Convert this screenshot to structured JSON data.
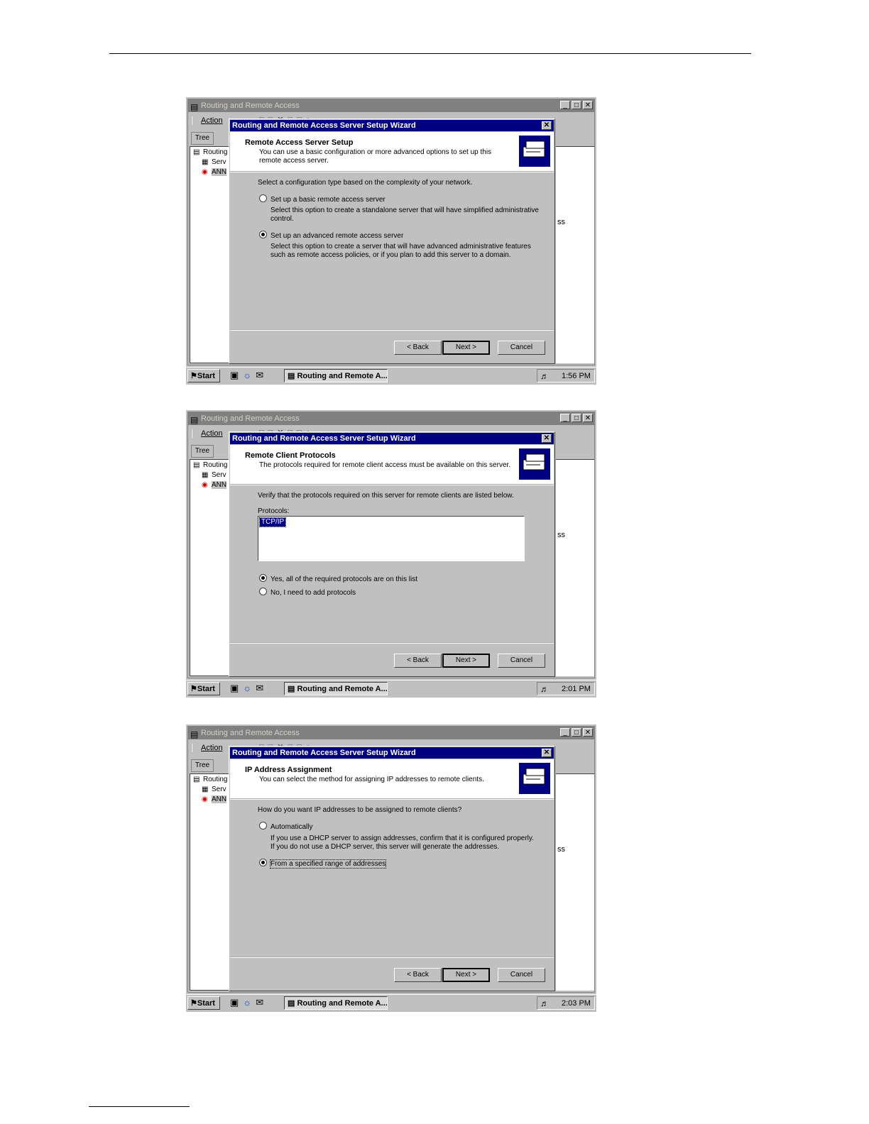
{
  "app_title": "Routing and Remote Access",
  "menu_action": "Action",
  "tree_tab": "Tree",
  "tree_items": [
    "Routing",
    "Serv",
    "ANN"
  ],
  "right_fragment": "ss",
  "start_label": "Start",
  "task_button": "Routing and Remote A...",
  "wizard_title": "Routing and Remote Access Server Setup Wizard",
  "buttons": {
    "back": "< Back",
    "next": "Next >",
    "cancel": "Cancel"
  },
  "screens": [
    {
      "clock": "1:56 PM",
      "header_title": "Remote Access Server Setup",
      "header_subtitle": "You can use a basic configuration or more advanced options to set up this remote access server.",
      "prompt": "Select a configuration type based on the complexity of your network.",
      "option1": "Set up a basic remote access server",
      "option1_desc": "Select this option to create a standalone server that will have simplified administrative control.",
      "option2": "Set up an advanced remote access server",
      "option2_desc": "Select this option to create a server that will have advanced administrative features such as remote access policies, or if you plan to add this server to a domain.",
      "selected": 2
    },
    {
      "clock": "2:01 PM",
      "header_title": "Remote Client Protocols",
      "header_subtitle": "The protocols required for remote client access must be available on this server.",
      "prompt": "Verify that the protocols required on this server for remote clients are listed below.",
      "list_label": "Protocols:",
      "list_items": [
        "TCP/IP"
      ],
      "option1": "Yes, all of the required protocols are on this list",
      "option2": "No, I need to add protocols",
      "selected": 1
    },
    {
      "clock": "2:03 PM",
      "header_title": "IP Address Assignment",
      "header_subtitle": "You can select the method for assigning IP addresses to remote clients.",
      "prompt": "How do you want IP addresses to be assigned to remote clients?",
      "option1": "Automatically",
      "option1_desc_line1": "If you use a DHCP server to assign addresses, confirm that it is configured properly.",
      "option1_desc_line2": "If you do not use a DHCP server, this server will generate the addresses.",
      "option2": "From a specified range of addresses",
      "selected": 2
    }
  ]
}
